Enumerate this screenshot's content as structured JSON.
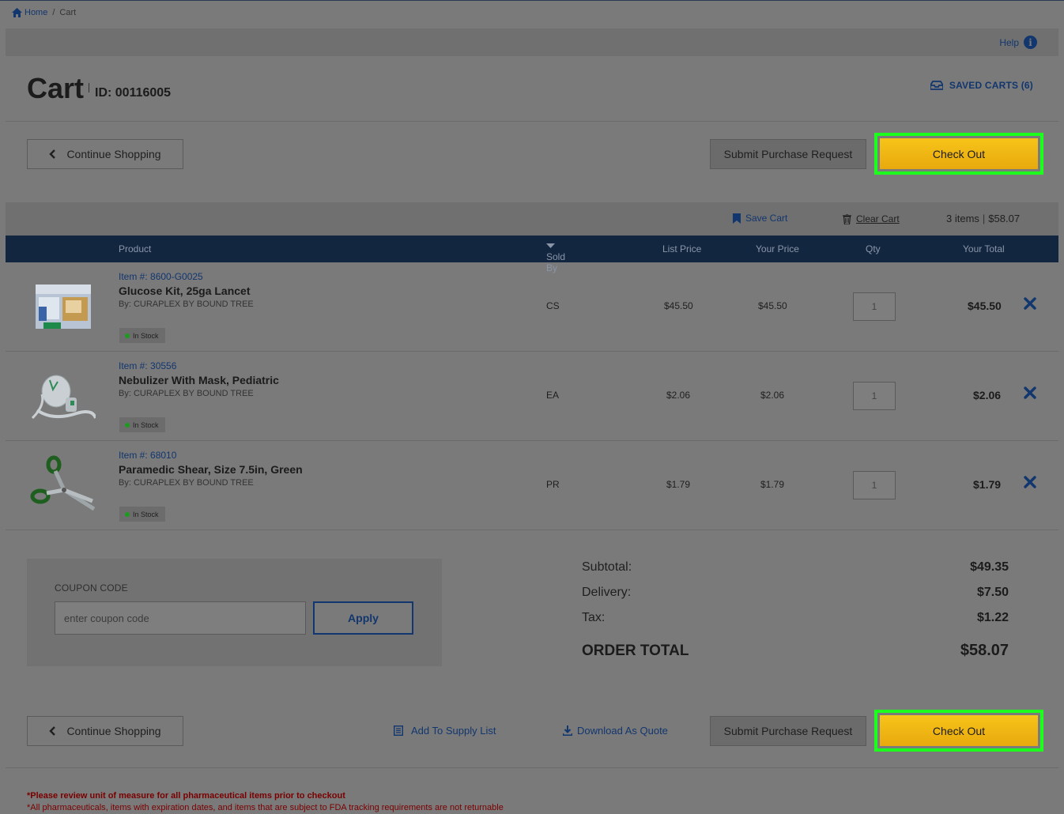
{
  "breadcrumb": {
    "home": "Home",
    "separator": "/",
    "current": "Cart"
  },
  "help": {
    "label": "Help"
  },
  "header": {
    "title": "Cart",
    "cart_id": "ID: 00116005",
    "saved_carts": "SAVED CARTS (6)"
  },
  "actions": {
    "continue_shopping": "Continue Shopping",
    "submit_purchase_request": "Submit Purchase Request",
    "check_out": "Check Out"
  },
  "toolbar": {
    "save_cart": "Save Cart",
    "clear_cart": "Clear Cart",
    "items_count": "3 items",
    "cart_total": "$58.07"
  },
  "table": {
    "headers": {
      "product": "Product",
      "sold_by": "Sold By",
      "list_price": "List Price",
      "your_price": "Your Price",
      "qty": "Qty",
      "your_total": "Your Total"
    },
    "rows": [
      {
        "item_no": "Item #: 8600-G0025",
        "name": "Glucose Kit, 25ga Lancet",
        "by": "By: CURAPLEX BY BOUND TREE",
        "stock": "In Stock",
        "sold_by": "CS",
        "list_price": "$45.50",
        "your_price": "$45.50",
        "qty": "1",
        "total": "$45.50"
      },
      {
        "item_no": "Item #: 30556",
        "name": "Nebulizer With Mask, Pediatric",
        "by": "By: CURAPLEX BY BOUND TREE",
        "stock": "In Stock",
        "sold_by": "EA",
        "list_price": "$2.06",
        "your_price": "$2.06",
        "qty": "1",
        "total": "$2.06"
      },
      {
        "item_no": "Item #: 68010",
        "name": "Paramedic Shear, Size 7.5in, Green",
        "by": "By: CURAPLEX BY BOUND TREE",
        "stock": "In Stock",
        "sold_by": "PR",
        "list_price": "$1.79",
        "your_price": "$1.79",
        "qty": "1",
        "total": "$1.79"
      }
    ]
  },
  "coupon": {
    "label": "COUPON CODE",
    "placeholder": "enter coupon code",
    "apply": "Apply"
  },
  "totals": {
    "subtotal_label": "Subtotal:",
    "subtotal": "$49.35",
    "delivery_label": "Delivery:",
    "delivery": "$7.50",
    "tax_label": "Tax:",
    "tax": "$1.22",
    "order_total_label": "ORDER TOTAL",
    "order_total": "$58.07"
  },
  "bottom_actions": {
    "add_to_supply_list": "Add To Supply List",
    "download_as_quote": "Download As Quote"
  },
  "notes": {
    "note1": "*Please review unit of measure for all pharmaceutical items prior to checkout",
    "note2": "*All pharmaceuticals, items with expiration dates, and items that are subject to FDA tracking requirements are not returnable"
  },
  "colors": {
    "navy": "#12366e",
    "checkout_yellow": "#f7c419",
    "highlight_green": "#1dff1d",
    "in_stock_green": "#1e9b1e",
    "table_header": "#13263f"
  }
}
